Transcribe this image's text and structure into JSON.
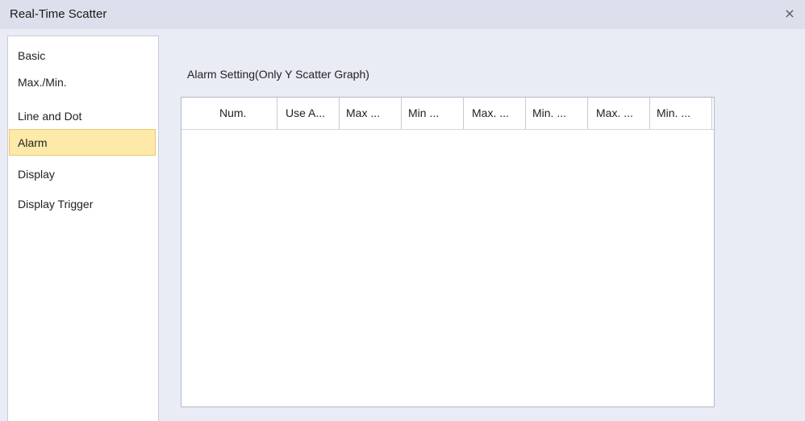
{
  "window": {
    "title": "Real-Time Scatter",
    "close_symbol": "×"
  },
  "sidebar": {
    "items": [
      {
        "label": "Basic",
        "selected": false
      },
      {
        "label": "Max./Min.",
        "selected": false
      },
      {
        "label": "Line and Dot",
        "selected": false
      },
      {
        "label": "Alarm",
        "selected": true
      },
      {
        "label": "Display",
        "selected": false
      },
      {
        "label": "Display Trigger",
        "selected": false
      }
    ]
  },
  "main": {
    "section_label": "Alarm Setting(Only Y Scatter Graph)",
    "grid": {
      "columns": [
        "Num.",
        "Use A...",
        "Max ...",
        "Min ...",
        "Max. ...",
        "Min. ...",
        "Max. ...",
        "Min. ..."
      ],
      "rows": []
    }
  },
  "colors": {
    "selected_bg": "#fde9a8",
    "window_bg": "#e9ebf5",
    "titlebar_bg": "#dde0ec"
  }
}
